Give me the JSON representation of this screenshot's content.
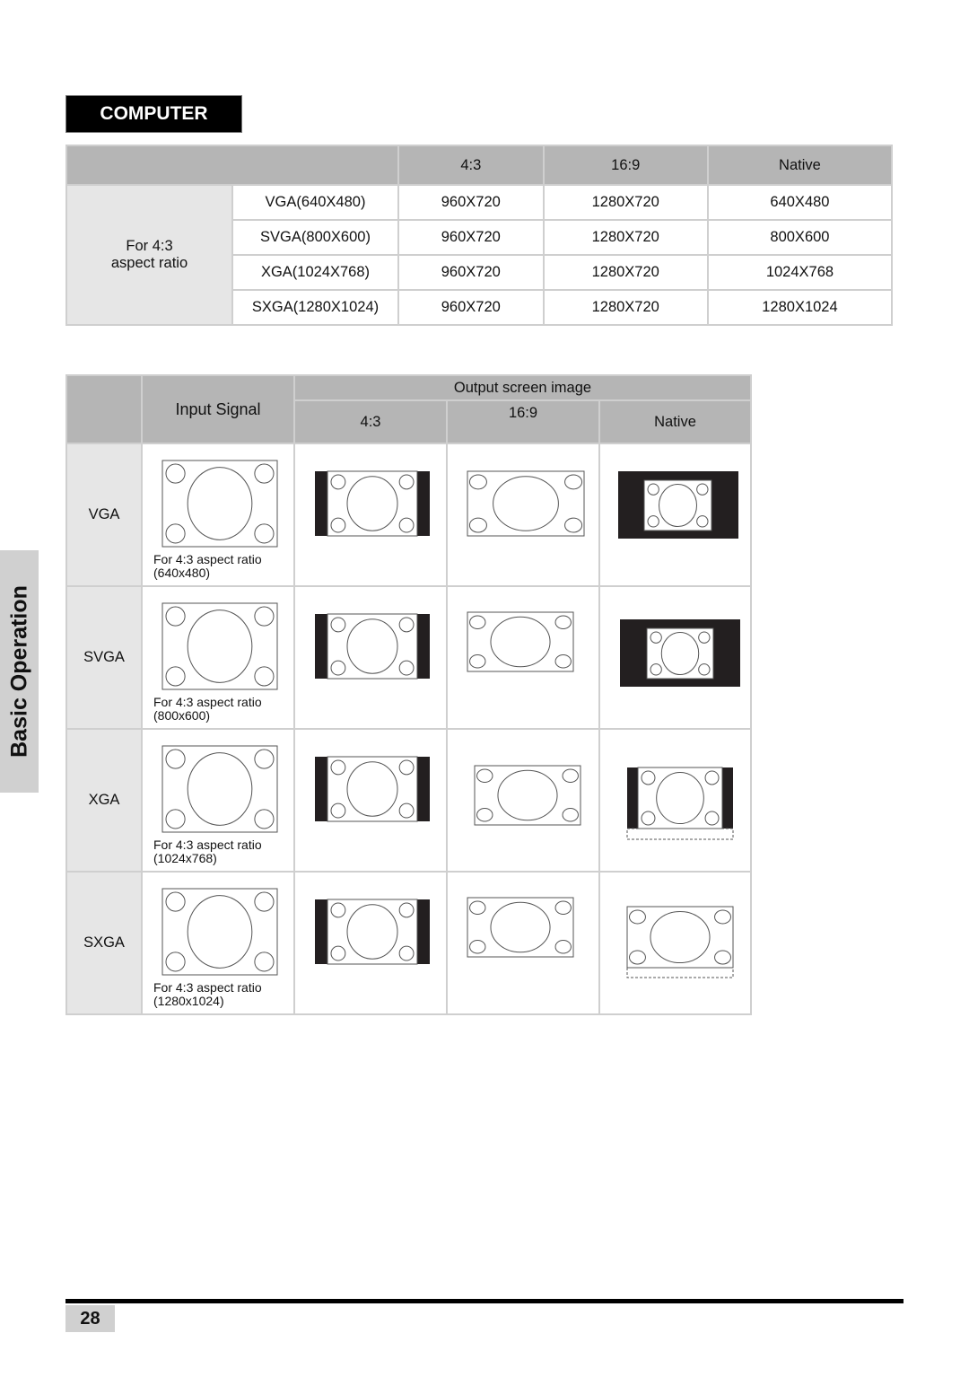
{
  "section": {
    "title": "COMPUTER",
    "side_tab": "Basic Operation",
    "page_number": "28"
  },
  "table1": {
    "headers": [
      "",
      "4:3",
      "16:9",
      "Native"
    ],
    "group_label_line1": "For 4:3",
    "group_label_line2": "aspect ratio",
    "rows": [
      {
        "signal": "VGA(640X480)",
        "r43": "960X720",
        "r169": "1280X720",
        "native": "640X480"
      },
      {
        "signal": "SVGA(800X600)",
        "r43": "960X720",
        "r169": "1280X720",
        "native": "800X600"
      },
      {
        "signal": "XGA(1024X768)",
        "r43": "960X720",
        "r169": "1280X720",
        "native": "1024X768"
      },
      {
        "signal": "SXGA(1280X1024)",
        "r43": "960X720",
        "r169": "1280X720",
        "native": "1280X1024"
      }
    ]
  },
  "table2": {
    "input_header": "Input Signal",
    "output_header": "Output screen image",
    "columns": [
      "4:3",
      "16:9",
      "Native"
    ],
    "rows": [
      {
        "name": "VGA",
        "caption1": "For 4:3 aspect ratio",
        "caption2": "(640x480)",
        "native_mode": "boxed-small"
      },
      {
        "name": "SVGA",
        "caption1": "For 4:3 aspect ratio",
        "caption2": "(800x600)",
        "native_mode": "boxed-medium"
      },
      {
        "name": "XGA",
        "caption1": "For 4:3 aspect ratio",
        "caption2": "(1024x768)",
        "native_mode": "pillarbox-cropped"
      },
      {
        "name": "SXGA",
        "caption1": "For 4:3 aspect ratio",
        "caption2": "(1280x1024)",
        "native_mode": "full-cropped"
      }
    ]
  }
}
